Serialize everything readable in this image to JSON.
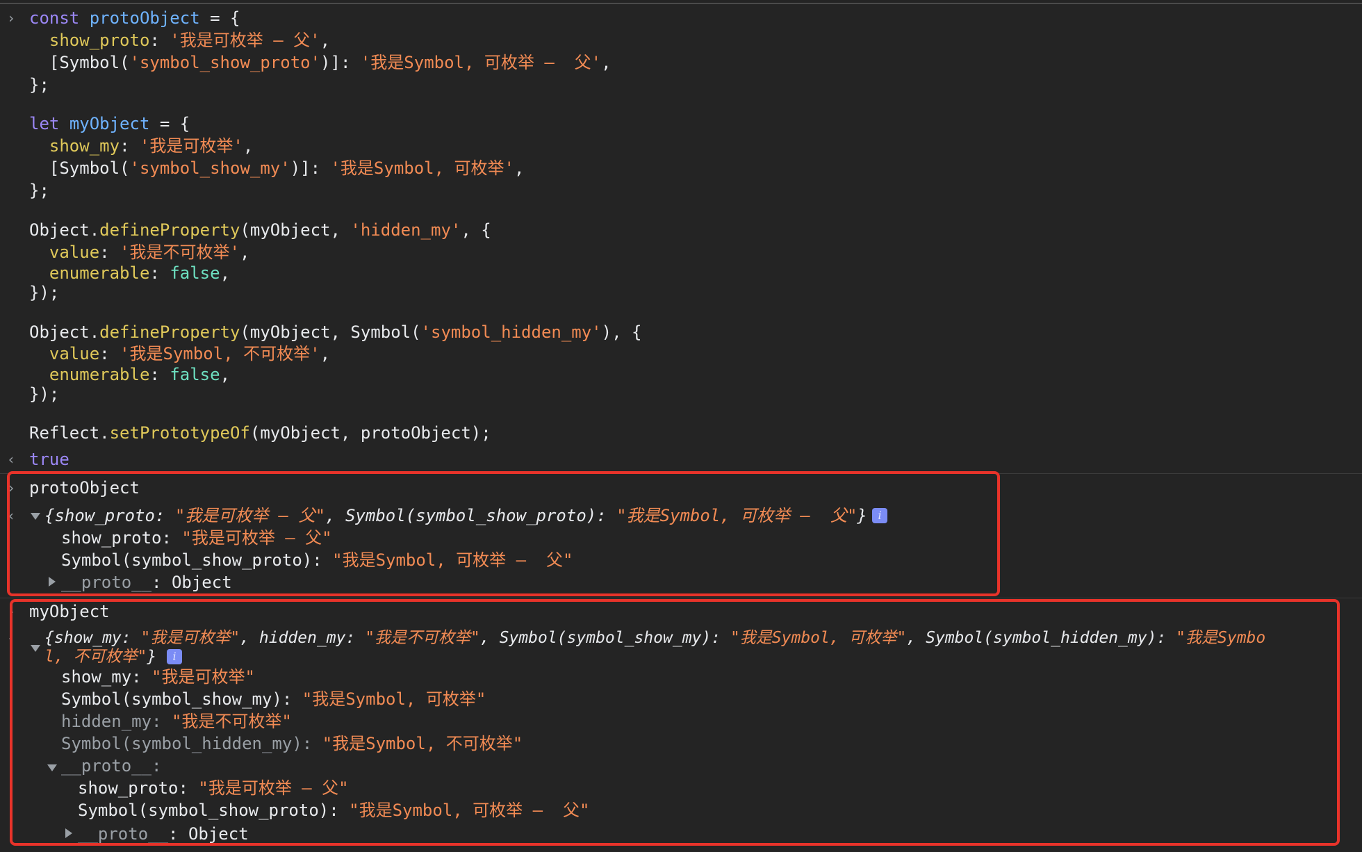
{
  "input_code": {
    "l1": [
      "const",
      "protoObject",
      "= {"
    ],
    "l2": [
      "show_proto",
      ": ",
      "'我是可枚举 – 父'",
      ","
    ],
    "l3": [
      "[Symbol(",
      "'symbol_show_proto'",
      ")]: ",
      "'我是Symbol, 可枚举 –  父'",
      ","
    ],
    "l4": "};",
    "l5": [
      "let",
      "myObject",
      "= {"
    ],
    "l6": [
      "show_my",
      ": ",
      "'我是可枚举'",
      ","
    ],
    "l7": [
      "[Symbol(",
      "'symbol_show_my'",
      ")]: ",
      "'我是Symbol, 可枚举'",
      ","
    ],
    "l8": "};",
    "l9": [
      "Object.",
      "defineProperty",
      "(myObject, ",
      "'hidden_my'",
      ", {"
    ],
    "l10": [
      "value",
      ": ",
      "'我是不可枚举'",
      ","
    ],
    "l11": [
      "enumerable",
      ": ",
      "false",
      ","
    ],
    "l12": "});",
    "l13": [
      "Object.",
      "defineProperty",
      "(myObject, Symbol(",
      "'symbol_hidden_my'",
      "), {"
    ],
    "l14": [
      "value",
      ": ",
      "'我是Symbol, 不可枚举'",
      ","
    ],
    "l15": [
      "enumerable",
      ": ",
      "false",
      ","
    ],
    "l16": "});",
    "l17": [
      "Reflect.",
      "setPrototypeOf",
      "(myObject, protoObject);"
    ]
  },
  "result": "true",
  "block1": {
    "input": "protoObject",
    "summary": [
      "{show_proto: ",
      "\"我是可枚举 – 父\"",
      ", Symbol(symbol_show_proto): ",
      "\"我是Symbol, 可枚举 –  父\"",
      "}"
    ],
    "row1": [
      "show_proto: ",
      "\"我是可枚举 – 父\""
    ],
    "row2": [
      "Symbol(symbol_show_proto): ",
      "\"我是Symbol, 可枚举 –  父\""
    ],
    "row3": [
      "__proto__",
      ": Object"
    ]
  },
  "block2": {
    "input": "myObject",
    "summary1": [
      "{show_my: ",
      "\"我是可枚举\"",
      ", hidden_my: ",
      "\"我是不可枚举\"",
      ", Symbol(symbol_show_my): ",
      "\"我是Symbol, 可枚举\"",
      ", Symbol(symbol_hidden_my): ",
      "\"我是Symbo"
    ],
    "summary2": [
      "l, 不可枚举\"",
      "}"
    ],
    "row1": [
      "show_my: ",
      "\"我是可枚举\""
    ],
    "row2": [
      "Symbol(symbol_show_my): ",
      "\"我是Symbol, 可枚举\""
    ],
    "row3": [
      "hidden_my: ",
      "\"我是不可枚举\""
    ],
    "row4": [
      "Symbol(symbol_hidden_my): ",
      "\"我是Symbol, 不可枚举\""
    ],
    "row5": "__proto__:",
    "row6": [
      "show_proto: ",
      "\"我是可枚举 – 父\""
    ],
    "row7": [
      "Symbol(symbol_show_proto): ",
      "\"我是Symbol, 可枚举 –  父\""
    ],
    "row8": [
      "__proto__",
      ": Object"
    ]
  },
  "colors": {
    "background": "#242424",
    "keyword": "#9b87f5",
    "variable": "#6fb3ff",
    "property": "#e0c95a",
    "string": "#f28b54",
    "boolean": "#6ee0c1",
    "highlight_box": "#e8332a"
  }
}
